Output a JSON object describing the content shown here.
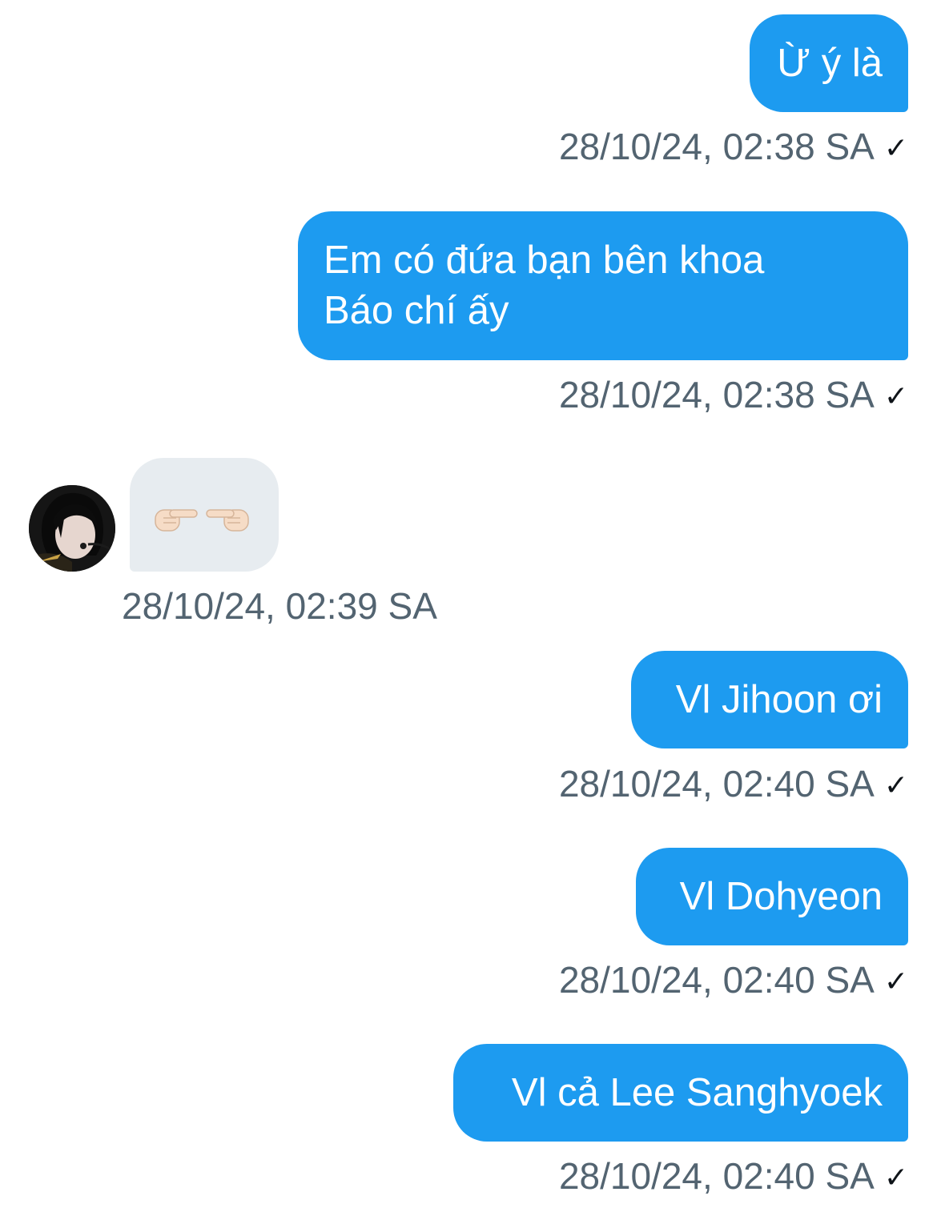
{
  "messages": [
    {
      "direction": "sent",
      "text": "Ừ ý là",
      "time": "28/10/24, 02:38 SA",
      "status": "✓"
    },
    {
      "direction": "sent",
      "text_lines": [
        "Em có đứa bạn bên khoa",
        "Báo chí ấy"
      ],
      "time": "28/10/24, 02:38 SA",
      "status": "✓"
    },
    {
      "direction": "received",
      "content": "👉👈",
      "time": "28/10/24, 02:39 SA"
    },
    {
      "direction": "sent",
      "text": "Vl Jihoon ơi",
      "time": "28/10/24, 02:40 SA",
      "status": "✓"
    },
    {
      "direction": "sent",
      "text": "Vl Dohyeon",
      "time": "28/10/24, 02:40 SA",
      "status": "✓"
    },
    {
      "direction": "sent",
      "text": "Vl cả Lee Sanghyoek",
      "time": "28/10/24, 02:40 SA",
      "status": "✓"
    }
  ],
  "colors": {
    "sent_bubble": "#1d9bf0",
    "received_bubble": "#e7ecf0",
    "timestamp": "#536471"
  },
  "icons": {
    "read_status": "checkmark-icon",
    "emoji": "pointing-fingers-emoji"
  }
}
